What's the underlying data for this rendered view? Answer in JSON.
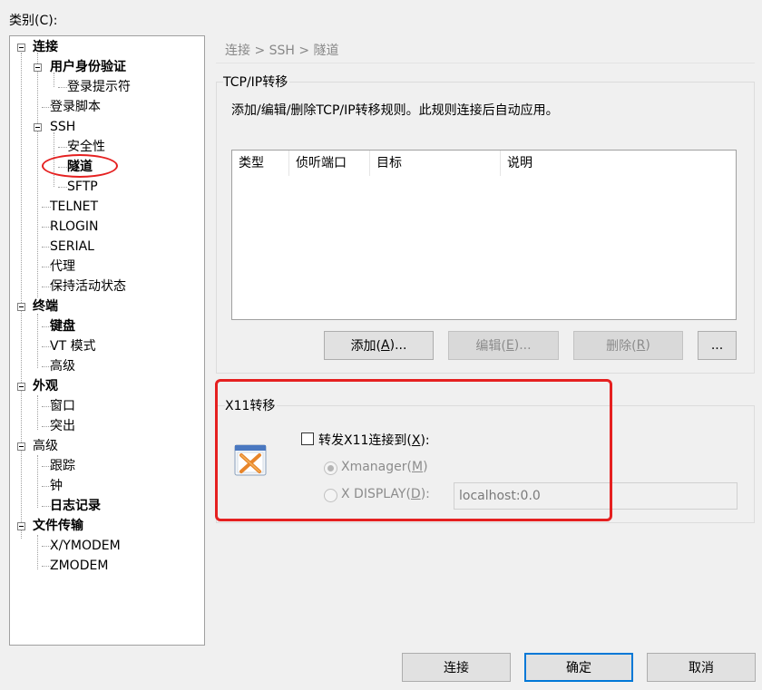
{
  "category_label": "类别(C):",
  "tree": {
    "items": [
      {
        "id": "connection",
        "label": "连接",
        "bold": true
      },
      {
        "id": "user-auth",
        "label": "用户身份验证",
        "bold": true
      },
      {
        "id": "login-prompt",
        "label": "登录提示符",
        "bold": false
      },
      {
        "id": "login-script",
        "label": "登录脚本",
        "bold": false
      },
      {
        "id": "ssh",
        "label": "SSH",
        "bold": false
      },
      {
        "id": "security",
        "label": "安全性",
        "bold": false
      },
      {
        "id": "tunnel",
        "label": "隧道",
        "bold": true
      },
      {
        "id": "sftp",
        "label": "SFTP",
        "bold": false
      },
      {
        "id": "telnet",
        "label": "TELNET",
        "bold": false
      },
      {
        "id": "rlogin",
        "label": "RLOGIN",
        "bold": false
      },
      {
        "id": "serial",
        "label": "SERIAL",
        "bold": false
      },
      {
        "id": "proxy",
        "label": "代理",
        "bold": false
      },
      {
        "id": "keepalive",
        "label": "保持活动状态",
        "bold": false
      },
      {
        "id": "terminal",
        "label": "终端",
        "bold": true
      },
      {
        "id": "keyboard",
        "label": "键盘",
        "bold": true
      },
      {
        "id": "vt-mode",
        "label": "VT 模式",
        "bold": false
      },
      {
        "id": "terminal-advanced",
        "label": "高级",
        "bold": false
      },
      {
        "id": "appearance",
        "label": "外观",
        "bold": true
      },
      {
        "id": "window",
        "label": "窗口",
        "bold": false
      },
      {
        "id": "highlight",
        "label": "突出",
        "bold": false
      },
      {
        "id": "advanced",
        "label": "高级",
        "bold": false
      },
      {
        "id": "trace",
        "label": "跟踪",
        "bold": false
      },
      {
        "id": "bell",
        "label": "钟",
        "bold": false
      },
      {
        "id": "logging",
        "label": "日志记录",
        "bold": true
      },
      {
        "id": "file-transfer",
        "label": "文件传输",
        "bold": true
      },
      {
        "id": "xymodem",
        "label": "X/YMODEM",
        "bold": false
      },
      {
        "id": "zmodem",
        "label": "ZMODEM",
        "bold": false
      }
    ]
  },
  "breadcrumb": "连接 > SSH > 隧道",
  "tcpip": {
    "title": "TCP/IP转移",
    "description": "添加/编辑/删除TCP/IP转移规则。此规则连接后自动应用。",
    "columns": [
      "类型",
      "侦听端口",
      "目标",
      "说明"
    ],
    "buttons": {
      "add": {
        "text": "添加(",
        "key": "A",
        "suffix": ")..."
      },
      "edit": {
        "text": "编辑(",
        "key": "E",
        "suffix": ")..."
      },
      "delete": {
        "text": "删除(",
        "key": "R",
        "suffix": ")"
      },
      "more": "..."
    }
  },
  "x11": {
    "title": "X11转移",
    "checkbox": {
      "text": "转发X11连接到(",
      "key": "X",
      "suffix": "):"
    },
    "xmanager": {
      "text": "Xmanager(",
      "key": "M",
      "suffix": ")"
    },
    "xdisplay": {
      "text": "X DISPLAY(",
      "key": "D",
      "suffix": "):"
    },
    "display_value": "localhost:0.0"
  },
  "footer": {
    "connect": "连接",
    "ok": "确定",
    "cancel": "取消"
  },
  "colors": {
    "highlight_red": "#e52020",
    "primary_border": "#0078d7"
  }
}
